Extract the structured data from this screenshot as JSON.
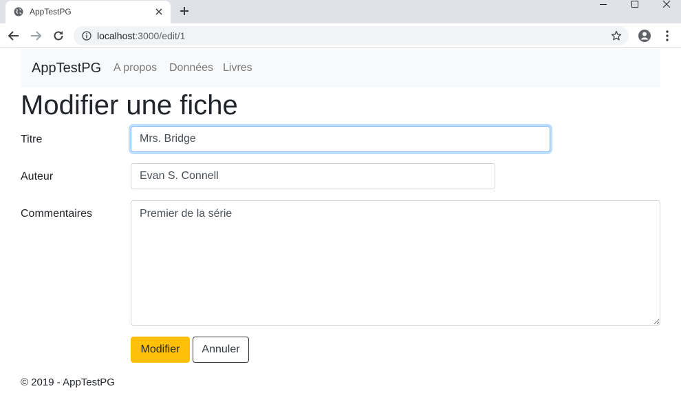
{
  "browser": {
    "tab_title": "AppTestPG",
    "url_host": "localhost",
    "url_path": ":3000/edit/1",
    "icons": {
      "favicon": "globe-icon",
      "tab_close": "close-icon",
      "new_tab": "plus-icon",
      "back": "arrow-left-icon",
      "forward": "arrow-right-icon",
      "reload": "reload-icon",
      "info": "info-icon",
      "bookmark": "star-icon",
      "profile": "account-circle-icon",
      "menu": "kebab-menu-icon"
    }
  },
  "navbar": {
    "brand": "AppTestPG",
    "links": [
      "A propos",
      "Données",
      "Livres"
    ]
  },
  "page": {
    "title": "Modifier une fiche"
  },
  "form": {
    "titre_label": "Titre",
    "titre_value": "Mrs. Bridge",
    "auteur_label": "Auteur",
    "auteur_value": "Evan S. Connell",
    "commentaires_label": "Commentaires",
    "commentaires_value": "Premier de la série",
    "submit_label": "Modifier",
    "cancel_label": "Annuler"
  },
  "footer": {
    "text": "© 2019 - AppTestPG"
  },
  "colors": {
    "primary_button": "#ffc107",
    "navbar_bg": "#f8f9fa",
    "focus_border": "#80bdff"
  }
}
